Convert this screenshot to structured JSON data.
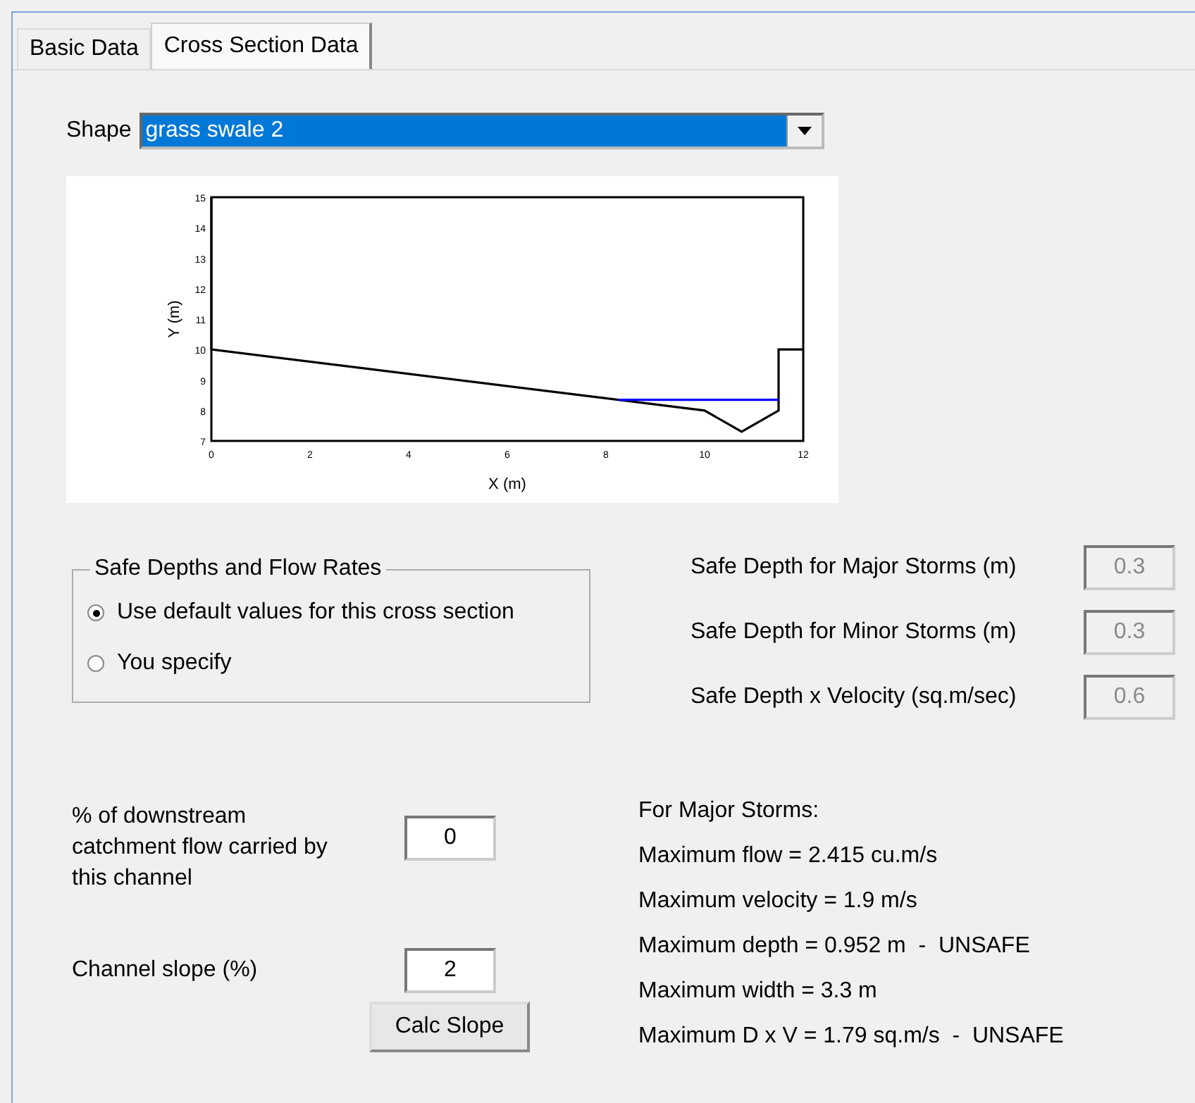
{
  "tabs": [
    {
      "label": "Basic Data",
      "selected": false
    },
    {
      "label": "Cross Section Data",
      "selected": true
    }
  ],
  "shape": {
    "label": "Shape",
    "value": "grass swale 2"
  },
  "chart": {
    "chart_data": {
      "type": "line",
      "xlabel": "X (m)",
      "ylabel": "Y (m)",
      "xlim": [
        0,
        12
      ],
      "ylim": [
        7,
        15
      ],
      "xticks": [
        0,
        2,
        4,
        6,
        8,
        10,
        12
      ],
      "yticks": [
        7,
        8,
        9,
        10,
        11,
        12,
        13,
        14,
        15
      ],
      "x": [
        0,
        0,
        8.25,
        10,
        10.75,
        11.5,
        11.5,
        12
      ],
      "series": [
        {
          "color": "#000000",
          "values": [
            15,
            10,
            8.35,
            8,
            7.3,
            8,
            10,
            10
          ]
        },
        {
          "color": "#0000ff",
          "values": [
            null,
            null,
            8.35,
            8.35,
            8.35,
            8.35,
            null,
            null
          ]
        }
      ]
    }
  },
  "safe_group": {
    "title": "Safe Depths and Flow Rates",
    "options": [
      {
        "label": "Use default values for this cross section",
        "selected": true
      },
      {
        "label": "You specify",
        "selected": false
      }
    ]
  },
  "safe_fields": [
    {
      "label": "Safe Depth for Major Storms (m)",
      "value": "0.3",
      "disabled": true
    },
    {
      "label": "Safe Depth for Minor Storms (m)",
      "value": "0.3",
      "disabled": true
    },
    {
      "label": "Safe Depth x Velocity (sq.m/sec)",
      "value": "0.6",
      "disabled": true
    }
  ],
  "downstream": {
    "label": "% of downstream catchment flow carried by this channel",
    "value": "0"
  },
  "slope": {
    "label": "Channel slope (%)",
    "value": "2",
    "button": "Calc Slope"
  },
  "results": {
    "heading": "For Major Storms:",
    "lines": [
      "Maximum flow = 2.415 cu.m/s",
      "Maximum velocity = 1.9 m/s",
      "Maximum depth = 0.952 m  -  UNSAFE",
      "Maximum width = 3.3 m",
      "Maximum D x V = 1.79 sq.m/s  -  UNSAFE"
    ]
  }
}
